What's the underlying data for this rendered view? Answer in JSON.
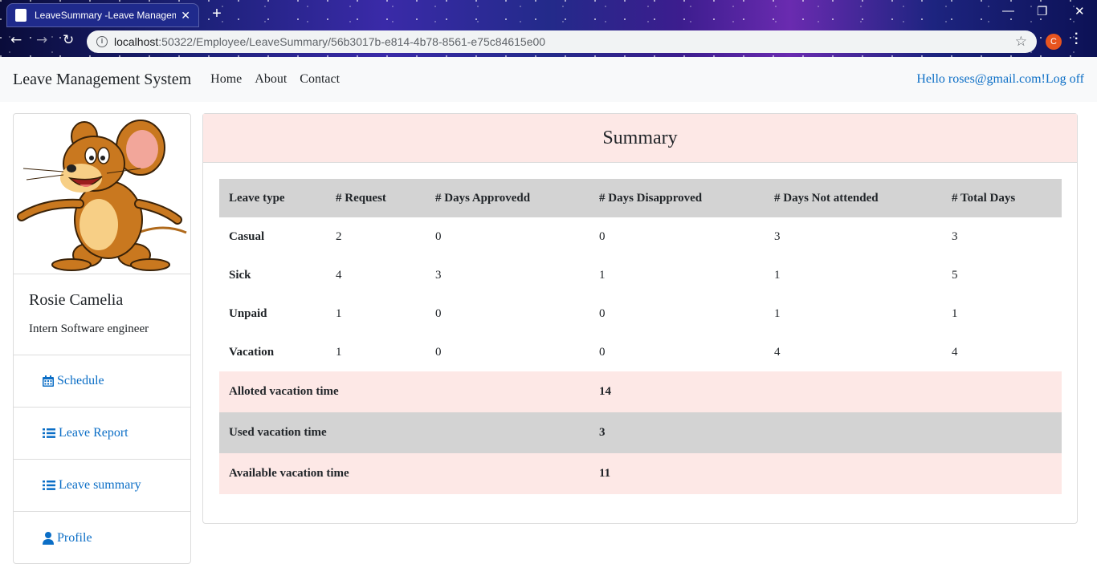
{
  "browser": {
    "tab_title": "LeaveSummary -Leave Management System",
    "url_host": "localhost",
    "url_rest": ":50322/Employee/LeaveSummary/56b3017b-e814-4b78-8561-e75c84615e00",
    "profile_initial": "C"
  },
  "navbar": {
    "brand": "Leave Management System",
    "links": [
      "Home",
      "About",
      "Contact"
    ],
    "greeting": "Hello roses@gmail.com!",
    "logoff": "Log off"
  },
  "profile": {
    "name": "Rosie Camelia",
    "title": "Intern Software engineer"
  },
  "sidebar": {
    "items": [
      {
        "label": "Schedule",
        "icon": "calendar-icon"
      },
      {
        "label": "Leave Report",
        "icon": "list-icon"
      },
      {
        "label": "Leave summary",
        "icon": "list-icon"
      },
      {
        "label": "Profile",
        "icon": "user-icon"
      }
    ]
  },
  "summary": {
    "title": "Summary",
    "columns": [
      "Leave type",
      "# Request",
      "# Days Approvedd",
      "# Days Disapproved",
      "# Days Not attended",
      "# Total Days"
    ],
    "rows": [
      [
        "Casual",
        "2",
        "0",
        "0",
        "3",
        "3"
      ],
      [
        "Sick",
        "4",
        "3",
        "1",
        "1",
        "5"
      ],
      [
        "Unpaid",
        "1",
        "0",
        "0",
        "1",
        "1"
      ],
      [
        "Vacation",
        "1",
        "0",
        "0",
        "4",
        "4"
      ]
    ],
    "totals": [
      {
        "label": "Alloted vacation time",
        "value": "14"
      },
      {
        "label": "Used vacation time",
        "value": "3"
      },
      {
        "label": "Available vacation time",
        "value": "11"
      }
    ]
  },
  "colors": {
    "link": "#0b6ec6",
    "header_pink": "#fde8e6",
    "table_gray": "#d3d3d3"
  }
}
